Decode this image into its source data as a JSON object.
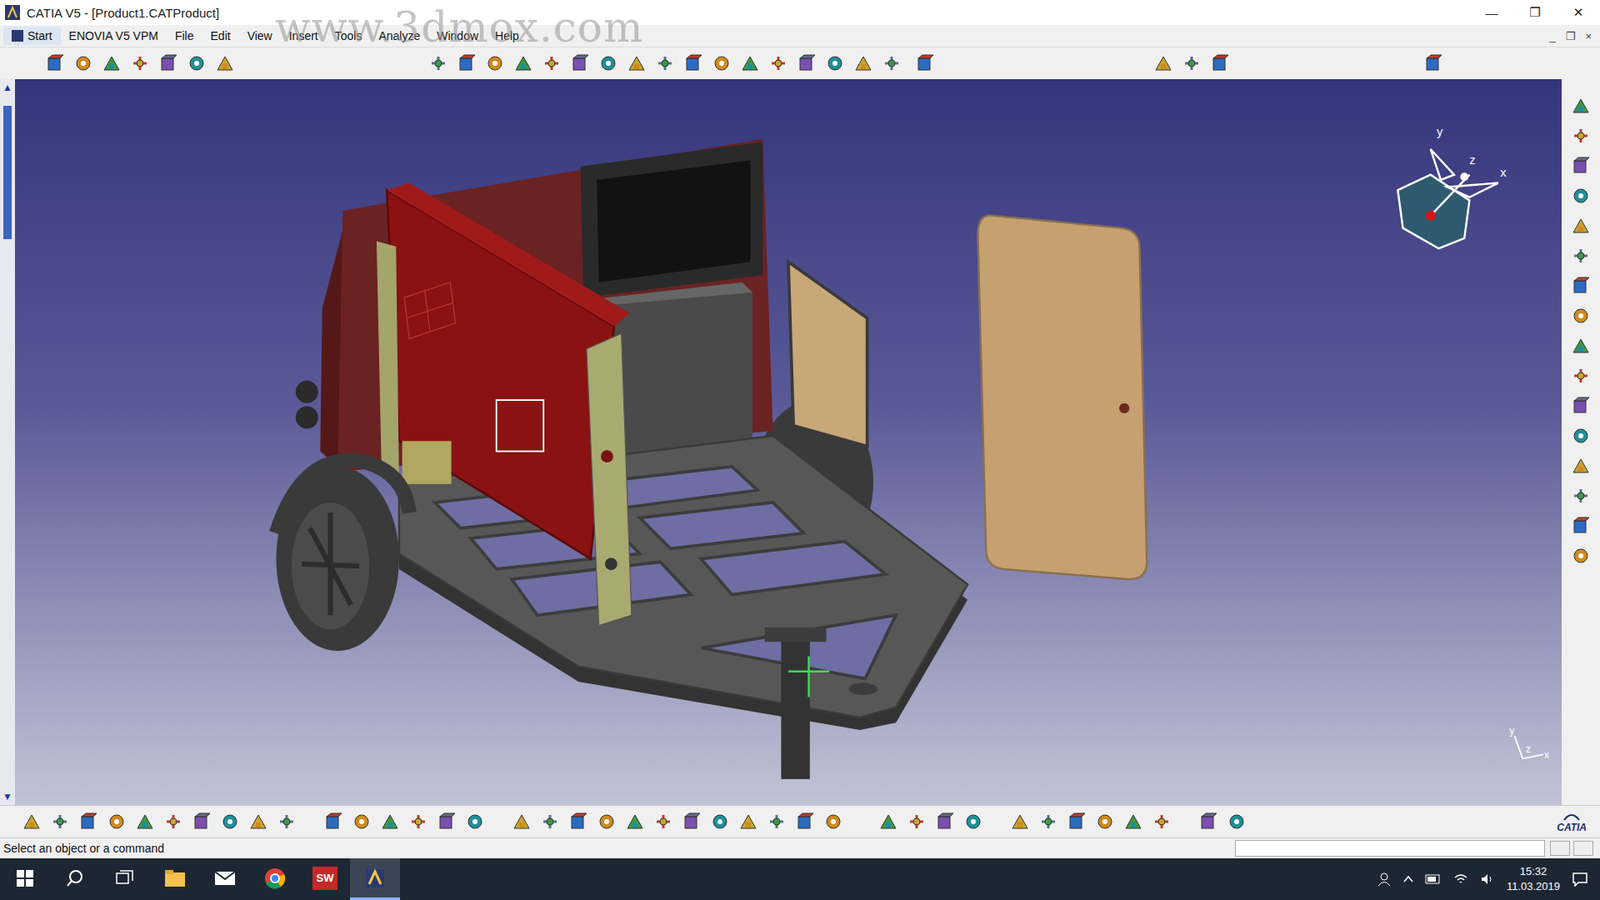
{
  "window": {
    "title": "CATIA V5 - [Product1.CATProduct]",
    "controls": [
      "—",
      "❐",
      "✕"
    ]
  },
  "document_controls": [
    "_",
    "❐",
    "×"
  ],
  "watermark": "www.3dmox.com",
  "menu": [
    {
      "label": "Start"
    },
    {
      "label": "ENOVIA V5 VPM"
    },
    {
      "label": "File"
    },
    {
      "label": "Edit"
    },
    {
      "label": "View"
    },
    {
      "label": "Insert"
    },
    {
      "label": "Tools"
    },
    {
      "label": "Analyze"
    },
    {
      "label": "Window"
    },
    {
      "label": "Help"
    }
  ],
  "compass": {
    "axes": [
      "y",
      "z",
      "x"
    ]
  },
  "axis_triad": [
    "y",
    "z",
    "x"
  ],
  "status_bar": {
    "message": "Select an object or a command"
  },
  "brand": "CATIA",
  "taskbar": {
    "apps": [
      {
        "kind": "explorer",
        "selected": false
      },
      {
        "kind": "mail",
        "selected": false
      },
      {
        "kind": "chrome",
        "selected": false
      },
      {
        "kind": "solidworks",
        "label": "SW",
        "selected": false
      },
      {
        "kind": "catia",
        "selected": true
      }
    ],
    "time": "15:32",
    "date": "11.03.2019"
  }
}
